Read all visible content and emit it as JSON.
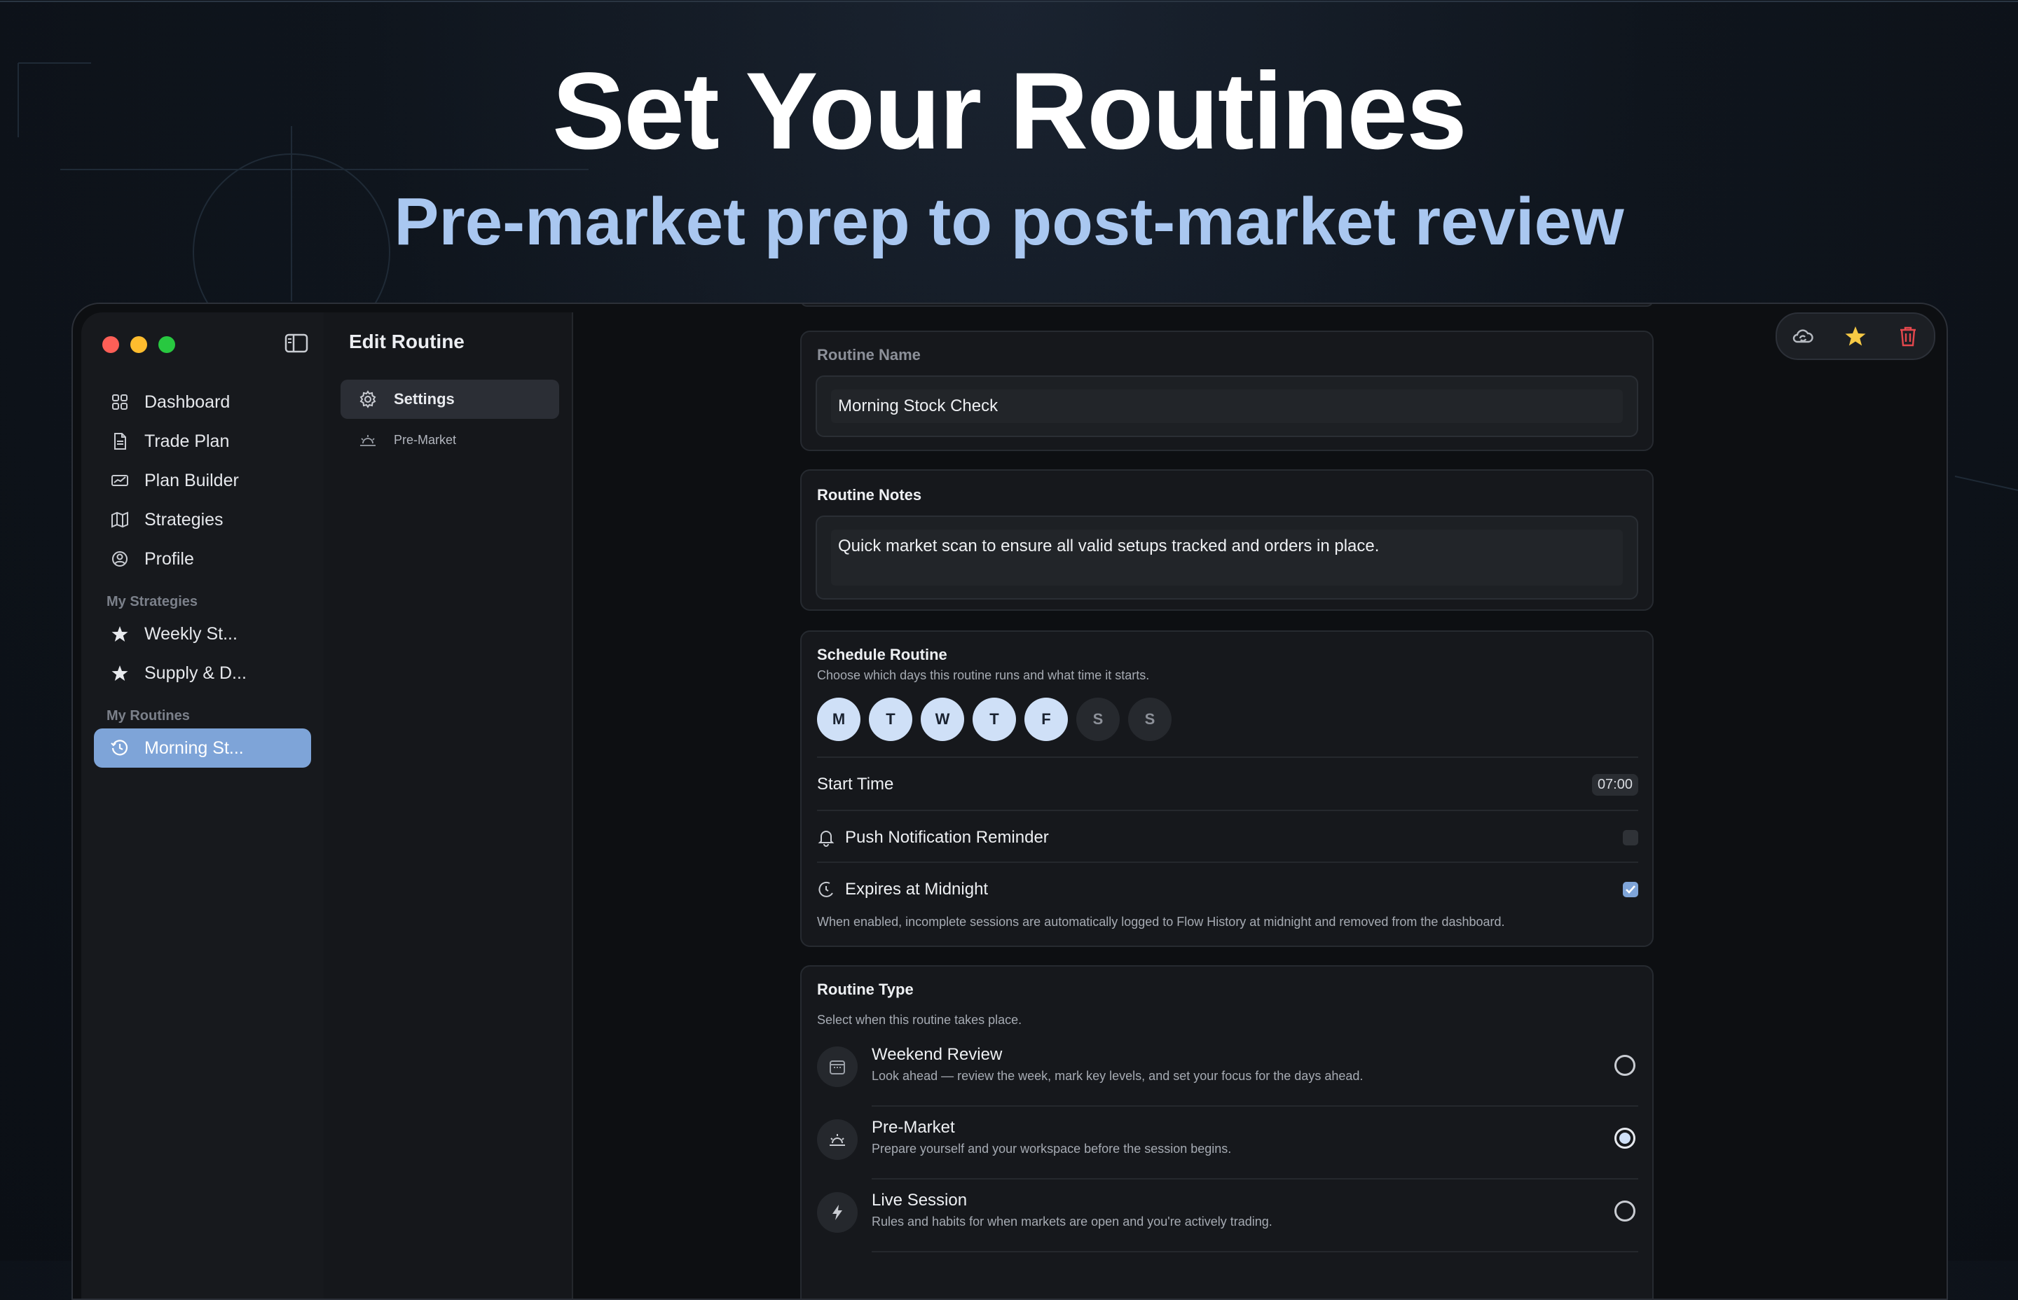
{
  "hero": {
    "title": "Set Your Routines",
    "subtitle": "Pre-market prep to post-market review"
  },
  "window": {
    "title": "Edit Routine",
    "traffic_lights": [
      "close",
      "minimize",
      "zoom"
    ]
  },
  "sidebar": {
    "nav": [
      {
        "label": "Dashboard",
        "icon": "grid-icon"
      },
      {
        "label": "Trade Plan",
        "icon": "document-icon"
      },
      {
        "label": "Plan Builder",
        "icon": "chart-card-icon"
      },
      {
        "label": "Strategies",
        "icon": "map-icon"
      },
      {
        "label": "Profile",
        "icon": "person-circle-icon"
      }
    ],
    "strategies_label": "My Strategies",
    "strategies": [
      {
        "label": "Weekly St...",
        "icon": "star-icon"
      },
      {
        "label": "Supply & D...",
        "icon": "star-icon"
      }
    ],
    "routines_label": "My Routines",
    "routines": [
      {
        "label": "Morning St...",
        "icon": "clock-history-icon",
        "active": true
      }
    ]
  },
  "editor_nav": {
    "items": [
      {
        "label": "Settings",
        "icon": "gear-icon",
        "active": true
      },
      {
        "label": "Pre-Market",
        "icon": "sunrise-icon",
        "active": false
      }
    ]
  },
  "toolbar": {
    "icons": [
      "cloud-sync-icon",
      "star-icon",
      "trash-icon"
    ],
    "colors": {
      "star": "#f6c945",
      "trash": "#e5484d"
    }
  },
  "routine_name": {
    "label": "Routine Name",
    "value": "Morning Stock Check"
  },
  "routine_notes": {
    "label": "Routine Notes",
    "value": "Quick market scan to ensure all valid setups tracked and orders in place."
  },
  "schedule": {
    "title": "Schedule Routine",
    "subtitle": "Choose which days this routine runs and what time it starts.",
    "days": [
      {
        "label": "M",
        "on": true
      },
      {
        "label": "T",
        "on": true
      },
      {
        "label": "W",
        "on": true
      },
      {
        "label": "T",
        "on": true
      },
      {
        "label": "F",
        "on": true
      },
      {
        "label": "S",
        "on": false
      },
      {
        "label": "S",
        "on": false
      }
    ],
    "start_time_label": "Start Time",
    "start_time": "07:00",
    "push_label": "Push Notification Reminder",
    "push_on": false,
    "expires_label": "Expires at Midnight",
    "expires_on": true,
    "expires_note": "When enabled, incomplete sessions are automatically logged to Flow History at midnight and removed from the dashboard."
  },
  "routine_type": {
    "title": "Routine Type",
    "subtitle": "Select when this routine takes place.",
    "options": [
      {
        "title": "Weekend Review",
        "desc": "Look ahead — review the week, mark key levels, and set your focus for the days ahead.",
        "icon": "calendar-icon",
        "selected": false
      },
      {
        "title": "Pre-Market",
        "desc": "Prepare yourself and your workspace before the session begins.",
        "icon": "sunrise-icon",
        "selected": true
      },
      {
        "title": "Live Session",
        "desc": "Rules and habits for when markets are open and you're actively trading.",
        "icon": "bolt-icon",
        "selected": false
      }
    ]
  },
  "colors": {
    "accent": "#7ea4d8",
    "subtitle": "#a9c7f0",
    "day_on": "#cfe0f7"
  }
}
